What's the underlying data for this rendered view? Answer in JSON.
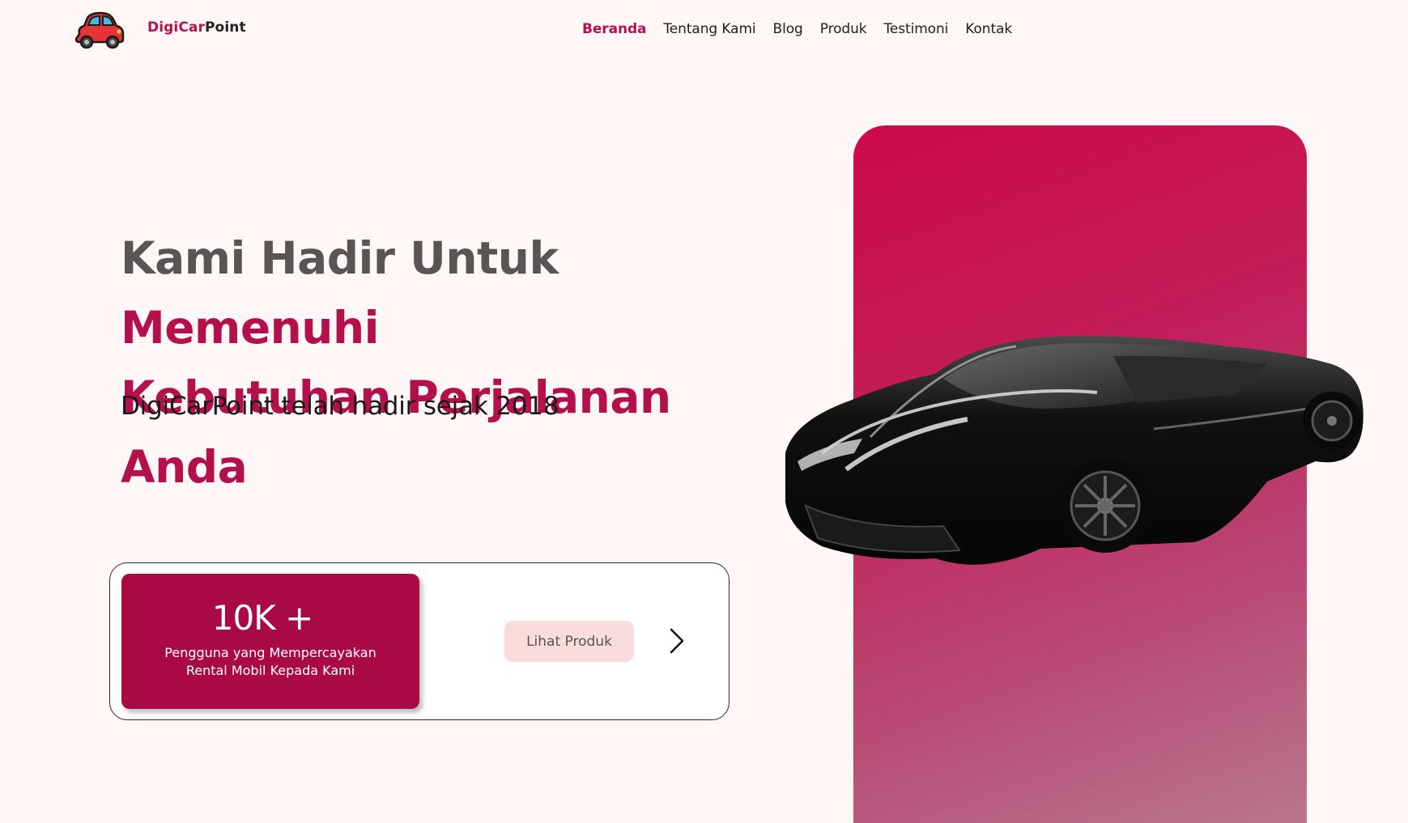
{
  "header": {
    "brand_part1": "Digi",
    "brand_part2": "Car",
    "brand_part3": "Point",
    "logo_icon": "car-icon",
    "nav": [
      {
        "label": "Beranda",
        "active": true
      },
      {
        "label": "Tentang Kami",
        "active": false
      },
      {
        "label": "Blog",
        "active": false
      },
      {
        "label": "Produk",
        "active": false
      },
      {
        "label": "Testimoni",
        "active": false
      },
      {
        "label": "Kontak",
        "active": false
      }
    ]
  },
  "hero": {
    "title_gray": "Kami Hadir Untuk ",
    "title_pink_1": "Memenuhi",
    "title_pink_2": "Kebutuhan Perjalanan Anda",
    "subtitle": "DigiCarPoint telah hadir sejak 2018"
  },
  "stats": {
    "number": "10K +",
    "description": "Pengguna yang Mempercayakan Rental Mobil Kepada Kami",
    "button_label": "Lihat Produk",
    "next_icon": "chevron-right-icon"
  },
  "visual": {
    "image": "sports-car-image",
    "panel_gradient": [
      "#cd0a4b",
      "#b87a90"
    ]
  },
  "colors": {
    "accent": "#b7124f",
    "background": "#fff6f6",
    "stat_box": "#a90a44",
    "button_bg": "#fadcdc"
  }
}
